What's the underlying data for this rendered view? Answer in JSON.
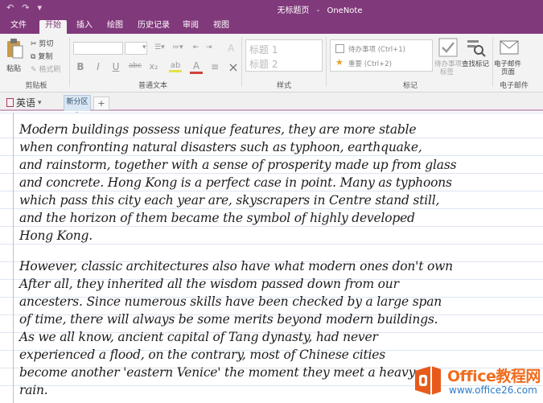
{
  "window": {
    "page_title": "无标题页",
    "dash": "-",
    "app_name": "OneNote"
  },
  "quick_access": {
    "undo_glyph": "↶",
    "redo_glyph": "↷",
    "more_glyph": "▾"
  },
  "tabs": [
    {
      "label": "文件"
    },
    {
      "label": "开始"
    },
    {
      "label": "插入"
    },
    {
      "label": "绘图"
    },
    {
      "label": "历史记录"
    },
    {
      "label": "审阅"
    },
    {
      "label": "视图"
    }
  ],
  "ribbon": {
    "clipboard": {
      "paste": "粘贴",
      "cut": "剪切",
      "copy": "复制",
      "format_painter": "格式刷",
      "label": "剪贴板"
    },
    "basic_text": {
      "label": "普通文本",
      "bold": "B",
      "italic": "I",
      "underline": "U",
      "strike": "abc",
      "subscript": "x₂",
      "highlight": "ab",
      "font_color": "A",
      "align": "≡",
      "clear": "×"
    },
    "styles": {
      "heading1": "标题 1",
      "heading2": "标题 2",
      "label": "样式"
    },
    "tags": {
      "todo": "待办事项 (Ctrl+1)",
      "important": "重要 (Ctrl+2)",
      "todo_tag": "待办事项",
      "todo_tag_sub": "标签",
      "find_tags": "查找标记",
      "label": "标记"
    },
    "email": {
      "email_page": "电子邮件",
      "email_page_sub": "页面",
      "label": "电子邮件"
    }
  },
  "notebook": {
    "name": "英语",
    "section": "新分区 1",
    "add_section": "+"
  },
  "page": {
    "paragraph1": [
      "Modern buildings possess    unique features, they are more stable",
      "when confronting natural disasters such as typhoon, earthquake,",
      "and rainstorm, together with a sense of prosperity made up from glass",
      "and concrete. Hong Kong is a perfect case in point. Many as typhoons",
      "which pass this city each year are, skyscrapers in Centre stand still,",
      "and the horizon of them became the symbol of highly developed",
      "Hong Kong."
    ],
    "paragraph2": [
      "However, classic architectures also have what modern ones don't own",
      "After all, they inherited all the wisdom passed down from our",
      "ancesters. Since numerous skills have been checked by a large span",
      "of time, there will always be some merits beyond modern buildings.",
      "As we all know, ancient capital of Tang dynasty, had never",
      "experienced a flood, on the contrary, most of Chinese cities",
      "become another 'eastern Venice' the moment they meet a heavy",
      "rain."
    ]
  },
  "watermark": {
    "title": "Office教程网",
    "url": "www.office26.com"
  }
}
